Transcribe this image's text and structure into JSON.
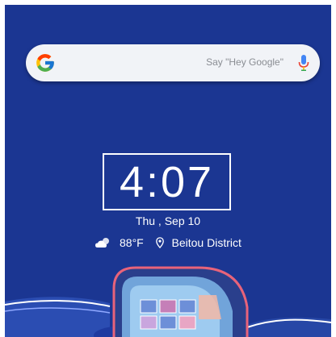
{
  "search": {
    "placeholder": "Say \"Hey Google\"",
    "logo_icon": "google-g-icon",
    "mic_icon": "microphone-icon"
  },
  "clock": {
    "time": "4:07",
    "date": "Thu , Sep 10"
  },
  "weather": {
    "condition_icon": "partly-cloudy-icon",
    "temperature": "88°F",
    "location_icon": "location-pin-icon",
    "location": "Beitou District"
  },
  "colors": {
    "wallpaper": "#1b3692",
    "search_bg": "#f1f3f7",
    "text": "#ffffff"
  }
}
